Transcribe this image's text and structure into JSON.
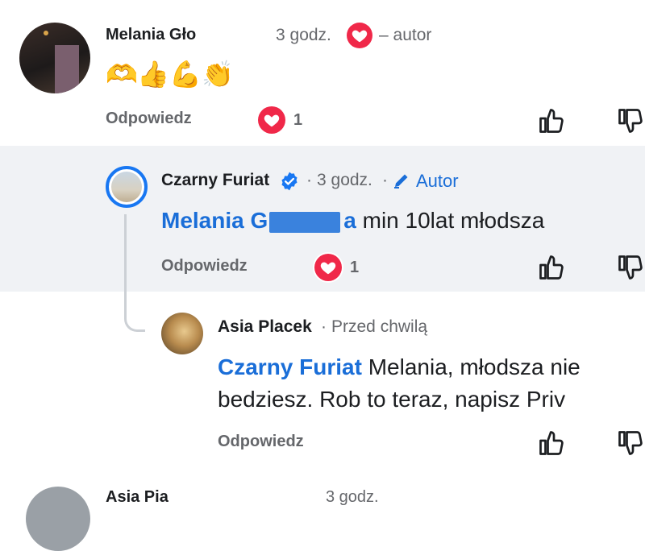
{
  "comment1": {
    "author": "Melania Gło",
    "time": "3 godz.",
    "author_badge": "– autor",
    "emojis": [
      "🫶",
      "👍",
      "💪",
      "👏"
    ],
    "reply_label": "Odpowiedz",
    "reaction_count": "1"
  },
  "comment2": {
    "author": "Czarny Furiat",
    "sep": "·",
    "time": "3 godz.",
    "author_badge": "Autor",
    "mention": "Melania G",
    "mention_tail": "a",
    "text": " min 10lat młodsza",
    "reply_label": "Odpowiedz",
    "reaction_count": "1"
  },
  "comment3": {
    "author": "Asia Placek",
    "sep": "·",
    "time": "Przed chwilą",
    "mention": "Czarny Furiat",
    "text_line1": " Melania, młodsza nie",
    "text_line2": "bedziesz. Rob to teraz, napisz Priv",
    "reply_label": "Odpowiedz"
  },
  "comment4": {
    "author_partial": "Asia Pia",
    "time_partial": "3 godz."
  },
  "colors": {
    "highlight_bg": "#f0f2f5",
    "mention_blue": "#1a6ed8",
    "verified_blue": "#1877f2",
    "love_red": "#f02849"
  }
}
